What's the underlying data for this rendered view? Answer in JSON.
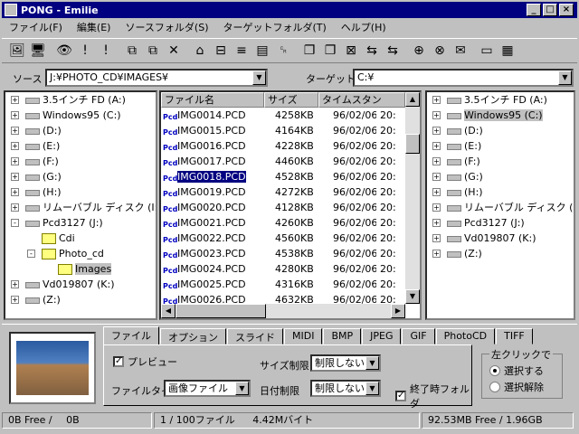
{
  "window": {
    "title": "PONG - Emilie",
    "minimize": "_",
    "maximize": "□",
    "close": "×"
  },
  "menu": [
    "ファイル(F)",
    "編集(E)",
    "ソースフォルダ(S)",
    "ターゲットフォルダ(T)",
    "ヘルプ(H)"
  ],
  "toolbar_icons": [
    "🖼",
    "🖥",
    "👁",
    "!",
    "!",
    "⧉",
    "⧉",
    "✕",
    "⌂",
    "⊟",
    "≡",
    "▤",
    "␍",
    "❐",
    "❐",
    "⊠",
    "⇆",
    "⇆",
    "⊕",
    "⊗",
    "✉",
    "▭",
    "▦"
  ],
  "source": {
    "label": "ソース",
    "path": "J:¥PHOTO_CD¥IMAGES¥"
  },
  "target": {
    "label": "ターゲット",
    "path": "C:¥"
  },
  "left_tree": [
    {
      "label": "3.5インチ FD (A:)",
      "type": "drive",
      "indent": 0,
      "exp": "+"
    },
    {
      "label": "Windows95 (C:)",
      "type": "drive",
      "indent": 0,
      "exp": "+"
    },
    {
      "label": "(D:)",
      "type": "drive",
      "indent": 0,
      "exp": "+"
    },
    {
      "label": "(E:)",
      "type": "drive",
      "indent": 0,
      "exp": "+"
    },
    {
      "label": "(F:)",
      "type": "drive",
      "indent": 0,
      "exp": "+"
    },
    {
      "label": "(G:)",
      "type": "drive",
      "indent": 0,
      "exp": "+"
    },
    {
      "label": "(H:)",
      "type": "drive",
      "indent": 0,
      "exp": "+"
    },
    {
      "label": "リムーバブル ディスク (I:)",
      "type": "drive",
      "indent": 0,
      "exp": "+"
    },
    {
      "label": "Pcd3127 (J:)",
      "type": "drive",
      "indent": 0,
      "exp": "-"
    },
    {
      "label": "Cdi",
      "type": "folder",
      "indent": 1,
      "exp": ""
    },
    {
      "label": "Photo_cd",
      "type": "folder",
      "indent": 1,
      "exp": "-"
    },
    {
      "label": "Images",
      "type": "folder",
      "indent": 2,
      "exp": "",
      "selected": true
    },
    {
      "label": "Vd019807 (K:)",
      "type": "drive",
      "indent": 0,
      "exp": "+"
    },
    {
      "label": "(Z:)",
      "type": "drive",
      "indent": 0,
      "exp": "+"
    }
  ],
  "right_tree": [
    {
      "label": "3.5インチ FD (A:)",
      "type": "drive",
      "indent": 0,
      "exp": "+"
    },
    {
      "label": "Windows95 (C:)",
      "type": "drive",
      "indent": 0,
      "exp": "+",
      "selected": true
    },
    {
      "label": "(D:)",
      "type": "drive",
      "indent": 0,
      "exp": "+"
    },
    {
      "label": "(E:)",
      "type": "drive",
      "indent": 0,
      "exp": "+"
    },
    {
      "label": "(F:)",
      "type": "drive",
      "indent": 0,
      "exp": "+"
    },
    {
      "label": "(G:)",
      "type": "drive",
      "indent": 0,
      "exp": "+"
    },
    {
      "label": "(H:)",
      "type": "drive",
      "indent": 0,
      "exp": "+"
    },
    {
      "label": "リムーバブル ディスク (I:)",
      "type": "drive",
      "indent": 0,
      "exp": "+"
    },
    {
      "label": "Pcd3127 (J:)",
      "type": "drive",
      "indent": 0,
      "exp": "+"
    },
    {
      "label": "Vd019807 (K:)",
      "type": "drive",
      "indent": 0,
      "exp": "+"
    },
    {
      "label": "(Z:)",
      "type": "drive",
      "indent": 0,
      "exp": "+"
    }
  ],
  "file_list": {
    "columns": [
      "ファイル名",
      "サイズ",
      "タイムスタン"
    ],
    "rows": [
      {
        "name": "IMG0014.PCD",
        "size": "4258KB",
        "date": "96/02/06",
        "time": "20:"
      },
      {
        "name": "IMG0015.PCD",
        "size": "4164KB",
        "date": "96/02/06",
        "time": "20:"
      },
      {
        "name": "IMG0016.PCD",
        "size": "4228KB",
        "date": "96/02/06",
        "time": "20:"
      },
      {
        "name": "IMG0017.PCD",
        "size": "4460KB",
        "date": "96/02/06",
        "time": "20:"
      },
      {
        "name": "IMG0018.PCD",
        "size": "4528KB",
        "date": "96/02/06",
        "time": "20:",
        "selected": true
      },
      {
        "name": "IMG0019.PCD",
        "size": "4272KB",
        "date": "96/02/06",
        "time": "20:"
      },
      {
        "name": "IMG0020.PCD",
        "size": "4128KB",
        "date": "96/02/06",
        "time": "20:"
      },
      {
        "name": "IMG0021.PCD",
        "size": "4260KB",
        "date": "96/02/06",
        "time": "20:"
      },
      {
        "name": "IMG0022.PCD",
        "size": "4560KB",
        "date": "96/02/06",
        "time": "20:"
      },
      {
        "name": "IMG0023.PCD",
        "size": "4538KB",
        "date": "96/02/06",
        "time": "20:"
      },
      {
        "name": "IMG0024.PCD",
        "size": "4280KB",
        "date": "96/02/06",
        "time": "20:"
      },
      {
        "name": "IMG0025.PCD",
        "size": "4316KB",
        "date": "96/02/06",
        "time": "20:"
      },
      {
        "name": "IMG0026.PCD",
        "size": "4632KB",
        "date": "96/02/06",
        "time": "20:"
      }
    ],
    "icon_text": "Pcd"
  },
  "tabs": [
    "ファイル",
    "オプション",
    "スライド",
    "MIDI",
    "BMP",
    "JPEG",
    "GIF",
    "PhotoCD",
    "TIFF"
  ],
  "options": {
    "preview_label": "プレビュー",
    "preview_checked": true,
    "filetype_label": "ファイルタイプ",
    "filetype_value": "画像ファイル",
    "size_limit_label": "サイズ制限",
    "size_limit_value": "制限しない",
    "date_limit_label": "日付制限",
    "date_limit_value": "制限しない",
    "end_folder_label": "終了時フォルダ",
    "end_folder_checked": true
  },
  "click_group": {
    "title": "左クリックで",
    "select": "選択する",
    "deselect": "選択解除",
    "selected": "select"
  },
  "status": {
    "left_free": "0B Free /",
    "left_total": "0B",
    "files": "1 / 100ファイル",
    "bytes": "4.42Mバイト",
    "right": "92.53MB Free / 1.96GB"
  }
}
